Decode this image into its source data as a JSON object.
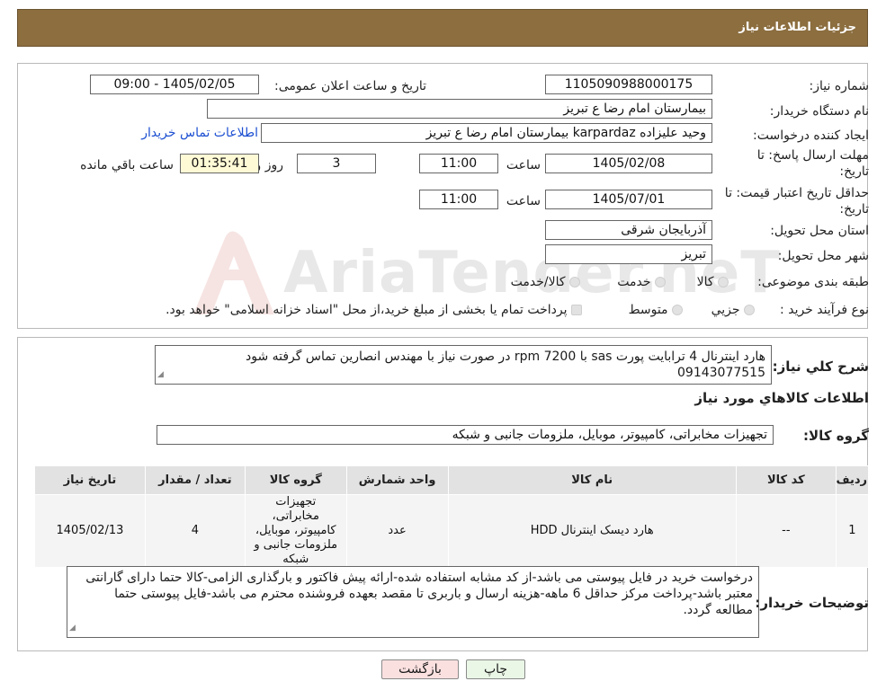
{
  "header": {
    "title": "جزئیات اطلاعات نیاز"
  },
  "form": {
    "need_number_label": "شماره نیاز:",
    "need_number": "1105090988000175",
    "announce_label": "تاریخ و ساعت اعلان عمومی:",
    "announce_value": "1405/02/05 - 09:00",
    "buyer_org_label": "نام دستگاه خریدار:",
    "buyer_org": "بیمارستان امام رضا  ع  تبریز",
    "creator_label": "ایجاد کننده درخواست:",
    "creator": "وحید علیزاده karpardaz بیمارستان امام رضا  ع  تبریز",
    "contact_link": "اطلاعات تماس خریدار",
    "reply_deadline_label": "مهلت ارسال پاسخ: تا تاریخ:",
    "reply_date": "1405/02/08",
    "time_label": "ساعت",
    "reply_time": "11:00",
    "days_value": "3",
    "days_and_label": "روز و",
    "remaining_time": "01:35:41",
    "remaining_label": "ساعت باقي مانده",
    "validity_label": "حداقل تاریخ اعتبار قیمت: تا تاریخ:",
    "validity_date": "1405/07/01",
    "validity_time": "11:00",
    "province_label": "استان محل تحویل:",
    "province": "آذربایجان شرقی",
    "city_label": "شهر محل تحویل:",
    "city": "تبریز",
    "category_label": "طبقه بندی موضوعی:",
    "category_options": [
      "کالا",
      "خدمت",
      "کالا/خدمت"
    ],
    "process_label": "نوع فرآیند خرید :",
    "process_options": [
      "جزیي",
      "متوسط"
    ],
    "process_note": "پرداخت تمام یا بخشی از مبلغ خرید،از محل \"اسناد خزانه اسلامی\" خواهد بود."
  },
  "description": {
    "label": "شرح کلي نياز:",
    "text": "هارد اینترنال 4 ترابایت پورت sas با rpm 7200 در صورت نیاز با مهندس انصارین تماس گرفته شود 09143077515"
  },
  "goods": {
    "section_title": "اطلاعات کالاهاي مورد نياز",
    "group_label": "گروه کالا:",
    "group_value": "تجهیزات مخابراتی، کامپیوتر، موبایل، ملزومات جانبی و شبکه",
    "table": {
      "headers": [
        "رديف",
        "کد کالا",
        "نام کالا",
        "واحد شمارش",
        "گروه کالا",
        "تعداد / مقدار",
        "تاريخ نياز"
      ],
      "rows": [
        [
          "1",
          "--",
          "هارد دیسک اینترنال HDD",
          "عدد",
          "تجهیزات مخابراتی، کامپیوتر، موبایل، ملزومات جانبی و شبکه",
          "4",
          "1405/02/13"
        ]
      ]
    }
  },
  "buyer_notes": {
    "label": "توضیحات خریدار:",
    "text": "درخواست خرید در فایل پیوستی می باشد-از کد مشابه استفاده شده-ارائه پیش فاکتور و بارگذاری الزامی-کالا حتما دارای گارانتی معتبر باشد-پرداخت مرکز حداقل 6 ماهه-هزینه ارسال و باربری تا مقصد بعهده فروشنده محترم می باشد-فایل پیوستی حتما مطالعه گردد."
  },
  "buttons": {
    "print": "چاپ",
    "back": "بازگشت"
  },
  "watermark": {
    "text": "AriaTender.neT"
  },
  "colors": {
    "header_bg": "#8c6e3f",
    "link": "#1c4fd1",
    "back_button_bg": "#fbe0e0",
    "print_button_bg": "#eaf6e6",
    "remaining_bg": "#fffad6"
  }
}
